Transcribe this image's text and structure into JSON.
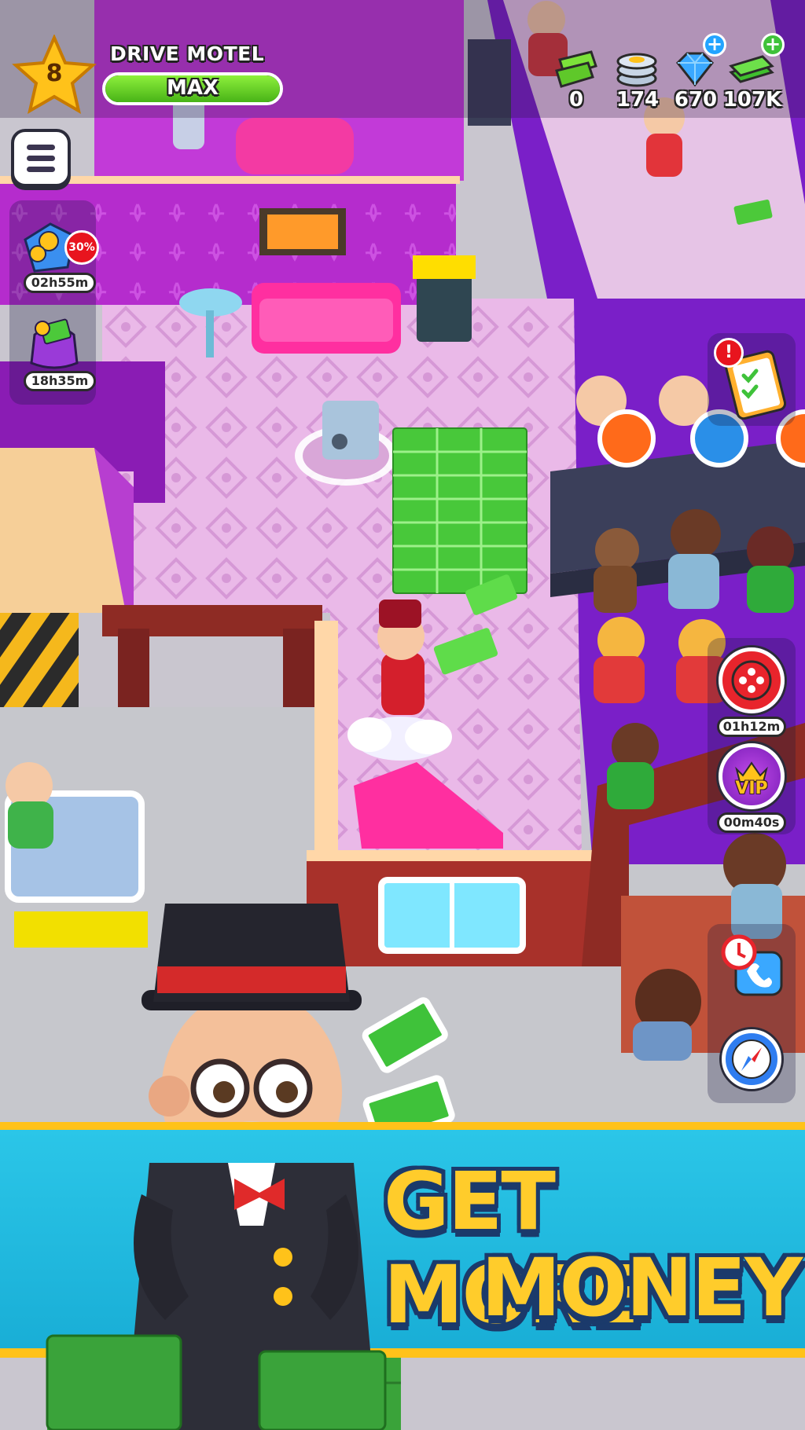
{
  "hud": {
    "level": "8",
    "motel_name": "DRIVE MOTEL",
    "progress_label": "MAX",
    "progress_fraction": 1.0,
    "resources": [
      {
        "name": "tickets",
        "icon": "ticket-icon",
        "value": "0",
        "has_plus": false
      },
      {
        "name": "coins",
        "icon": "coin-stack-icon",
        "value": "174",
        "has_plus": false
      },
      {
        "name": "gems",
        "icon": "gem-icon",
        "value": "670",
        "has_plus": true
      },
      {
        "name": "cash",
        "icon": "cash-icon",
        "value": "107K",
        "has_plus": true
      }
    ]
  },
  "left_offers": [
    {
      "icon": "coin-pack-icon",
      "badge": "30%",
      "timer": "02h55m"
    },
    {
      "icon": "money-bag-icon",
      "timer": "18h35m"
    }
  ],
  "right_buttons": [
    {
      "icon": "task-list-icon",
      "alert": "!"
    },
    {
      "icon": "film-reel-icon",
      "timer": "01h12m"
    },
    {
      "icon": "vip-crown-icon",
      "label": "VIP",
      "timer": "00m40s"
    },
    {
      "icon": "phone-call-icon"
    },
    {
      "icon": "compass-icon"
    }
  ],
  "banner": {
    "line1": "GET MORE",
    "line2": "MONEY"
  },
  "colors": {
    "wall_magenta": "#b62bd0",
    "floor_pink": "#e8b7e6",
    "banner_blue": "#22bde2",
    "banner_gold": "#ffc21a",
    "headline_yellow": "#ffcc2b",
    "cash_green": "#4cc93a"
  }
}
